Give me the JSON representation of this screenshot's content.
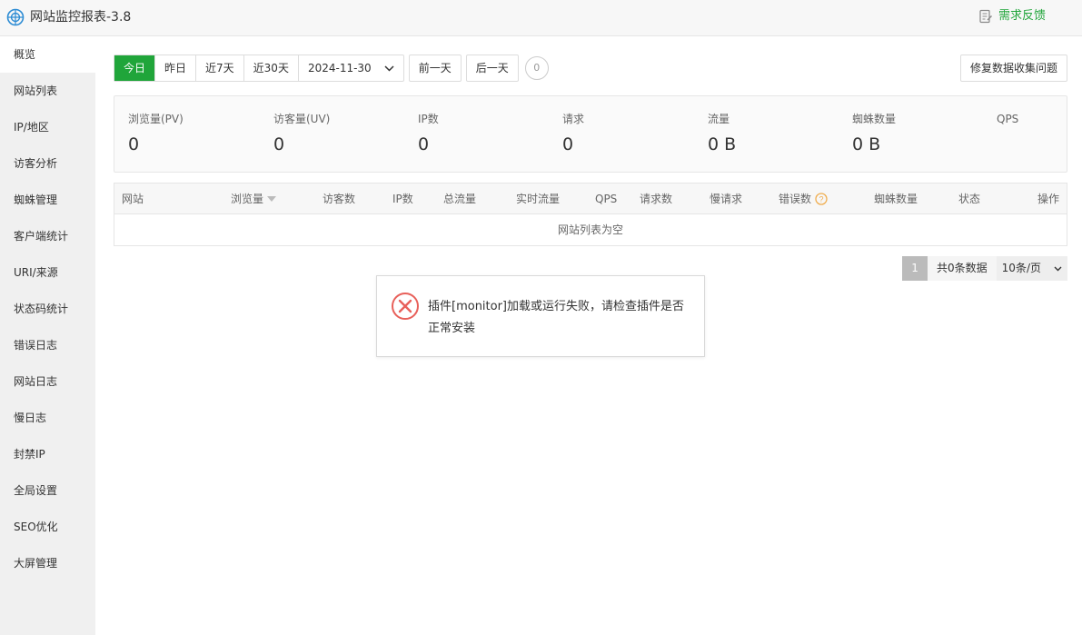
{
  "app": {
    "title": "网站监控报表-3.8",
    "feedback_label": "需求反馈"
  },
  "sidebar": {
    "items": [
      {
        "label": "概览",
        "active": true
      },
      {
        "label": "网站列表"
      },
      {
        "label": "IP/地区"
      },
      {
        "label": "访客分析"
      },
      {
        "label": "蜘蛛管理"
      },
      {
        "label": "客户端统计"
      },
      {
        "label": "URI/来源"
      },
      {
        "label": "状态码统计"
      },
      {
        "label": "错误日志"
      },
      {
        "label": "网站日志"
      },
      {
        "label": "慢日志"
      },
      {
        "label": "封禁IP"
      },
      {
        "label": "全局设置"
      },
      {
        "label": "SEO优化"
      },
      {
        "label": "大屏管理"
      }
    ]
  },
  "toolbar": {
    "ranges": [
      "今日",
      "昨日",
      "近7天",
      "近30天"
    ],
    "date": "2024-11-30",
    "prev_day": "前一天",
    "next_day": "后一天",
    "counter": "0",
    "repair": "修复数据收集问题"
  },
  "stats": [
    {
      "label": "浏览量(PV)",
      "value": "0"
    },
    {
      "label": "访客量(UV)",
      "value": "0"
    },
    {
      "label": "IP数",
      "value": "0"
    },
    {
      "label": "请求",
      "value": "0"
    },
    {
      "label": "流量",
      "value": "0 B"
    },
    {
      "label": "蜘蛛数量",
      "value": "0 B"
    },
    {
      "label": "QPS",
      "value": ""
    }
  ],
  "table": {
    "columns": [
      "网站",
      "浏览量",
      "访客数",
      "IP数",
      "总流量",
      "实时流量",
      "QPS",
      "请求数",
      "慢请求",
      "错误数",
      "蜘蛛数量",
      "状态",
      "操作"
    ],
    "empty_text": "网站列表为空"
  },
  "pager": {
    "page": "1",
    "total": "共0条数据",
    "page_size": "10条/页"
  },
  "toast": {
    "message": "插件[monitor]加载或运行失败，请检查插件是否正常安装"
  },
  "colors": {
    "accent": "#20a53a",
    "error": "#e8605a",
    "help": "#f0ad4e"
  }
}
